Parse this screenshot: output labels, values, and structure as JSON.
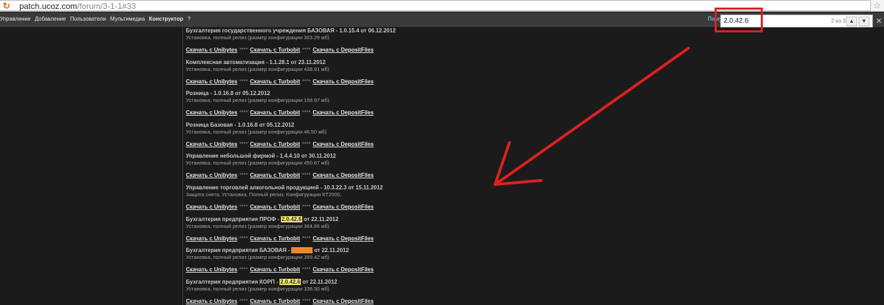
{
  "browser": {
    "url_host": "patch.ucoz.com",
    "url_path": "/forum/3-1-1#33"
  },
  "nav": {
    "items": [
      "Управление",
      "Добавление",
      "Пользователи",
      "Мультимедиа",
      "Конструктор",
      "?"
    ],
    "right_label": "Пому"
  },
  "find": {
    "query": "2.0.42.6",
    "count": "2 из 3"
  },
  "entries": [
    {
      "title": "Бухгалтерия государственного учреждения БАЗОВАЯ - 1.0.15.4 от 06.12.2012",
      "sub": "Установка, полный релиз (размер конфигурации 303.29 мб)"
    },
    {
      "title": "Комплексная автоматизация - 1.1.28.1 от 23.11.2012",
      "sub": "Установка, полный релиз (размер конфигурации 438.91 мб)"
    },
    {
      "title": "Розница - 1.0.16.8 от 05.12.2012",
      "sub": "Установка, полный релиз (размер конфигурации 158.97 мб)"
    },
    {
      "title": "Розница Базовая - 1.0.16.8 от 05.12.2012",
      "sub": "Установка, полный релиз (размер конфигурации 46.50 мб)"
    },
    {
      "title": "Управление небольшой фирмой - 1.4.4.10 от 30.11.2012",
      "sub": "Установка, полный релиз (размер конфигурации 450.67 мб)"
    },
    {
      "title": "Управление торговлей алкогольной продукцией - 10.3.22.3 от 15.11.2012",
      "sub": "Защита снята, Установка, Полный релиз, Конфигурация КТ2000,"
    },
    {
      "title_pre": "Бухгалтерия предприятия ПРОФ - ",
      "title_hl": "2.0.42.6",
      "title_post": " от 22.11.2012",
      "sub": "Установка, полный релиз (размер конфигурации 364.86 мб)"
    },
    {
      "title_pre": "Бухгалтерия предприятия БАЗОВАЯ - ",
      "title_hl": "2.0.42.6",
      "title_post": " от 22.11.2012",
      "sub": "Установка, полный релиз (размер конфигурации 399.42 мб)"
    },
    {
      "title_pre": "Бухгалтерия предприятия КОРП - ",
      "title_hl": "2.0.42.6",
      "title_post": " от 22.11.2012",
      "sub": "Установка, полный релиз (размер конфигурации 338.50 мб)"
    }
  ],
  "links": {
    "unibytes": "Скачать с Unibytes",
    "turbobit": "Скачать с Turbobit",
    "depositfiles": "Скачать с DepositFiles",
    "separator": "****"
  },
  "colors": {
    "find_highlight_current": "#e8892e",
    "find_highlight_other": "#f2e86d",
    "annotation": "#e02020"
  },
  "icons": [
    "reload-icon",
    "bookmark-star-icon",
    "chevron-up-icon",
    "chevron-down-icon",
    "close-icon"
  ]
}
